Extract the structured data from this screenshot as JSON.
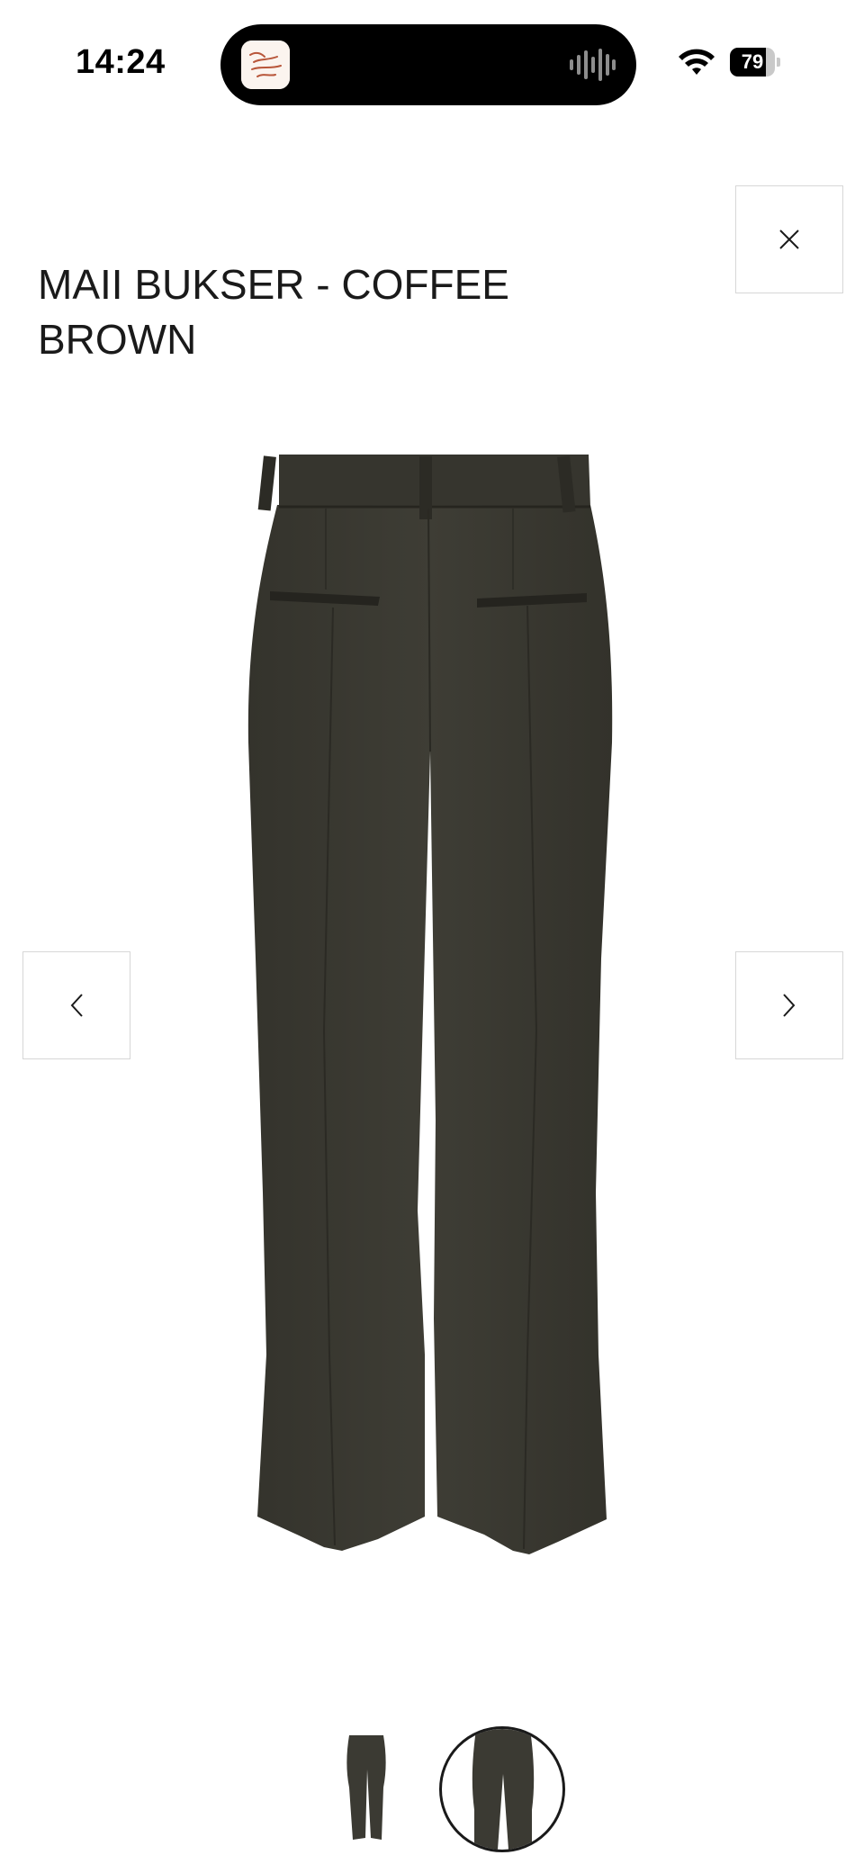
{
  "status_bar": {
    "time": "14:24",
    "battery_level": "79",
    "battery_fraction": 0.79,
    "icons": [
      "app-activity-icon",
      "audio-waveform-icon",
      "wifi-icon",
      "battery-icon"
    ]
  },
  "product": {
    "title": "MAII BUKSER - COFFEE BROWN",
    "image_color": "#3b3a33"
  },
  "controls": {
    "close_icon": "close-icon",
    "prev_icon": "chevron-left-icon",
    "next_icon": "chevron-right-icon"
  },
  "thumbnails": {
    "count": 2,
    "selected_index": 2
  },
  "colors": {
    "background": "#ffffff",
    "text": "#1a1a1a",
    "border": "#d7d7d7",
    "garment": "#3b3a33"
  }
}
